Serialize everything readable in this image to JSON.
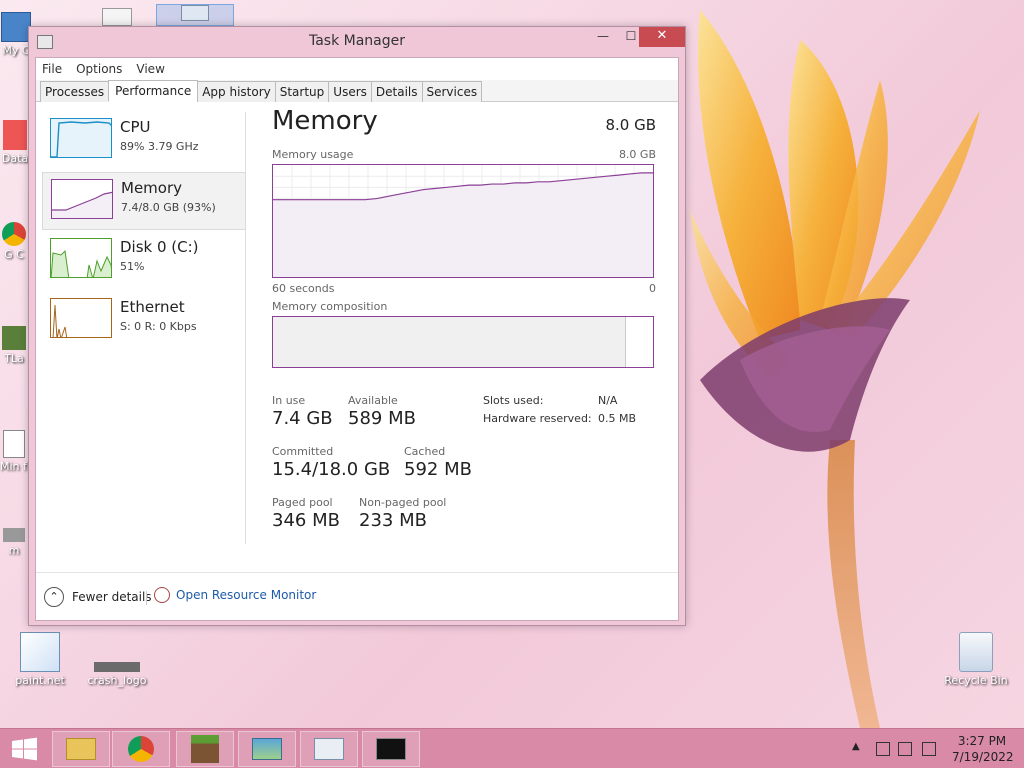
{
  "window": {
    "title": "Task Manager",
    "min_glyph": "—",
    "max_glyph": "☐",
    "close_glyph": "✕"
  },
  "menu": [
    "File",
    "Options",
    "View"
  ],
  "tabs": [
    "Processes",
    "Performance",
    "App history",
    "Startup",
    "Users",
    "Details",
    "Services"
  ],
  "active_tab": "Performance",
  "sidebar": [
    {
      "name": "CPU",
      "sub": "89%  3.79 GHz",
      "color": "#1b8fc7"
    },
    {
      "name": "Memory",
      "sub": "7.4/8.0 GB (93%)",
      "color": "#8b3f96"
    },
    {
      "name": "Disk 0 (C:)",
      "sub": "51%",
      "color": "#4da02b"
    },
    {
      "name": "Ethernet",
      "sub": "S: 0  R: 0 Kbps",
      "color": "#a7651c"
    }
  ],
  "memory": {
    "title": "Memory",
    "total": "8.0 GB",
    "usage_label": "Memory usage",
    "usage_max": "8.0 GB",
    "axis_left": "60 seconds",
    "axis_right": "0",
    "composition_label": "Memory composition",
    "composition_in_use_fraction": 0.93,
    "usage_series": [
      0.69,
      0.69,
      0.69,
      0.69,
      0.69,
      0.69,
      0.69,
      0.69,
      0.69,
      0.7,
      0.72,
      0.74,
      0.76,
      0.78,
      0.79,
      0.8,
      0.81,
      0.82,
      0.82,
      0.83,
      0.83,
      0.84,
      0.84,
      0.85,
      0.85,
      0.86,
      0.87,
      0.88,
      0.89,
      0.9,
      0.91,
      0.92,
      0.93,
      0.93
    ],
    "stats": {
      "in_use_label": "In use",
      "in_use": "7.4 GB",
      "available_label": "Available",
      "available": "589 MB",
      "committed_label": "Committed",
      "committed": "15.4/18.0 GB",
      "cached_label": "Cached",
      "cached": "592 MB",
      "paged_label": "Paged pool",
      "paged": "346 MB",
      "nonpaged_label": "Non-paged pool",
      "nonpaged": "233 MB",
      "slots_label": "Slots used:",
      "slots": "N/A",
      "hw_label": "Hardware reserved:",
      "hw": "0.5 MB"
    }
  },
  "footer": {
    "fewer": "Fewer details",
    "fewer_glyph": "⌃",
    "monitor": "Open Resource Monitor"
  },
  "desktop": {
    "left_labels": [
      "My C",
      "Data",
      "G C",
      "TLa",
      "Min free",
      "m"
    ],
    "paint": "paint.net",
    "crash": "crash_logo",
    "recycle": "Recycle Bin"
  },
  "tray": {
    "time": "3:27 PM",
    "date": "7/19/2022",
    "chevron_glyph": "▲"
  }
}
